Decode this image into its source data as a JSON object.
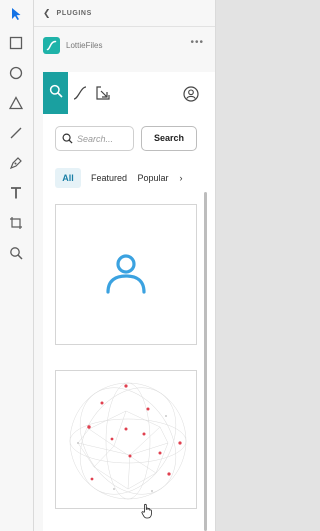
{
  "toolbar": {
    "tools": [
      {
        "name": "select",
        "icon": "arrow-pointer-icon",
        "active": true
      },
      {
        "name": "rectangle",
        "icon": "rectangle-icon"
      },
      {
        "name": "ellipse",
        "icon": "ellipse-icon"
      },
      {
        "name": "polygon",
        "icon": "triangle-icon"
      },
      {
        "name": "line",
        "icon": "line-icon"
      },
      {
        "name": "pen",
        "icon": "pen-icon"
      },
      {
        "name": "text",
        "icon": "text-icon"
      },
      {
        "name": "artboard",
        "icon": "artboard-icon"
      },
      {
        "name": "zoom",
        "icon": "zoom-icon"
      }
    ],
    "active_color": "#1473e6"
  },
  "panel": {
    "header_label": "PLUGINS",
    "plugin_name": "LottieFiles",
    "more_label": "•••",
    "accent_color": "#1aa0a0"
  },
  "tabs": [
    "search-icon",
    "animate-curve-icon",
    "import-arrow-icon",
    "account-icon"
  ],
  "search": {
    "placeholder": "Search...",
    "button_label": "Search"
  },
  "filters": {
    "all": "All",
    "featured": "Featured",
    "popular": "Popular",
    "next": "›"
  },
  "cards": [
    {
      "icon": "user-icon",
      "color": "#3ba2e0"
    },
    {
      "icon": "network-sphere-icon",
      "dot_color": "#e0404f"
    }
  ]
}
